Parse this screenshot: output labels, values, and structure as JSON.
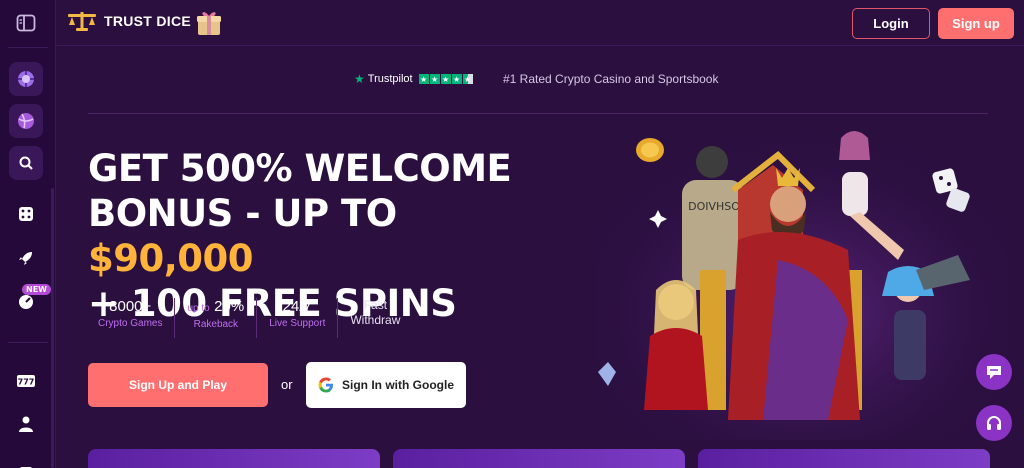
{
  "header": {
    "logo_text": "TRUST DICE",
    "login_label": "Login",
    "signup_label": "Sign up"
  },
  "sidebar": {
    "items": [
      {
        "icon": "panel-toggle-icon"
      },
      {
        "icon": "casino-chip-icon"
      },
      {
        "icon": "sports-ball-icon"
      },
      {
        "icon": "search-icon"
      },
      {
        "icon": "dice-icon"
      },
      {
        "icon": "rocket-icon"
      },
      {
        "icon": "new-games-icon",
        "badge": "NEW"
      },
      {
        "icon": "slots-777-icon"
      },
      {
        "icon": "live-dealer-icon"
      },
      {
        "icon": "more-icon"
      }
    ]
  },
  "trustpilot": {
    "label": "Trustpilot",
    "rated_text": "#1 Rated Crypto Casino and Sportsbook"
  },
  "hero": {
    "line1": "GET 500% WELCOME",
    "line2_prefix": "BONUS - UP TO ",
    "line2_amount": "$90,000",
    "line3": "+ 100 FREE SPINS",
    "stats": [
      {
        "big": "8000+",
        "small": "Crypto Games"
      },
      {
        "pre": "up to",
        "big": "20%",
        "small": "Rakeback"
      },
      {
        "big": "24/7",
        "small": "Live Support"
      },
      {
        "line1": "Fast",
        "line2": "Withdraw"
      }
    ],
    "play_label": "Sign Up and Play",
    "or_label": "or",
    "google_label": "Sign In with Google"
  },
  "colors": {
    "accent": "#ff6f6f",
    "gold": "#ffb33b",
    "purple_text": "#c16ef0",
    "background": "#2a0f3f"
  }
}
